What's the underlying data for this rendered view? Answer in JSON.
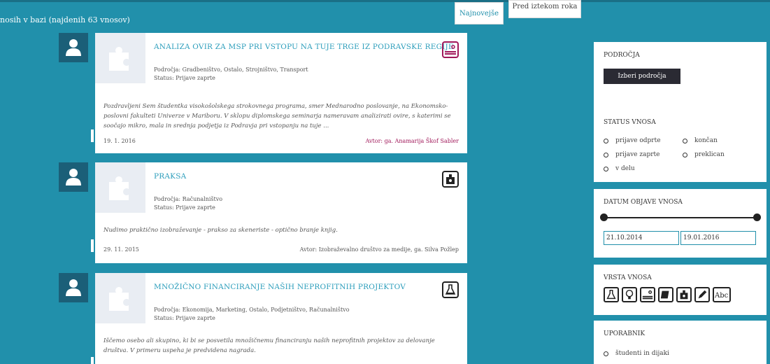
{
  "results": {
    "count_text": "nosih v bazi (najdenih 63 vnosov)"
  },
  "sort": {
    "newest": "Najnovejše",
    "before_deadline": "Pred iztekom roka"
  },
  "entries": [
    {
      "title": "ANALIZA OVIR ZA MSP PRI VSTOPU NA TUJE TRGE IZ PODRAVSKE REGIJE",
      "areas_label": "Področja:",
      "areas": "Gradbeništvo, Ostalo, Strojništvo, Transport",
      "status": "Status: Prijave zaprte",
      "excerpt": "Pozdravljeni Sem študentka visokošolskega strokovnega programa, smer Mednarodno poslovanje, na Ekonomsko-poslovni fakulteti Univerze v Mariboru. V sklopu diplomskega seminarja nameravam analizirati ovire, s katerimi se soočajo mikro, mala in srednja podjetja iz Podravja pri vstopanju na tuje ...",
      "date": "19. 1. 2016",
      "author": "Avtor: ga. Anamarija Škof Sabler",
      "type_icon": "report-icon"
    },
    {
      "title": "PRAKSA",
      "areas_label": "Področja:",
      "areas": "Računalništvo",
      "status": "Status: Prijave zaprte",
      "excerpt": "Nudimo praktično izobraževanje - prakso za skeneriste - optično branje knjig.",
      "date": "29. 11. 2015",
      "author": "Avtor: Izobraževalno društvo za medije, ga. Silva Požlep",
      "type_icon": "badge-icon"
    },
    {
      "title": "MNOŽIČNO FINANCIRANJE NAŠIH NEPROFITNIH PROJEKTOV",
      "areas_label": "Področja:",
      "areas": "Ekonomija, Marketing, Ostalo, Podjetništvo, Računalništvo",
      "status": "Status: Prijave zaprte",
      "excerpt": "Iščemo osebo ali skupino, ki bi se posvetila množičnemu financiranju naših neprofitnih projektov za delovanje društva. V primeru uspeha je predvidena nagrada.",
      "date": "",
      "author": "",
      "type_icon": "flask-icon"
    }
  ],
  "filters": {
    "areas": {
      "title": "PODROČJA",
      "button": "Izberi področja"
    },
    "status": {
      "title": "STATUS VNOSA",
      "options": [
        "prijave odprte",
        "končan",
        "prijave zaprte",
        "preklican",
        "v delu"
      ]
    },
    "date": {
      "title": "DATUM OBJAVE VNOSA",
      "from": "21.10.2014",
      "to": "19.01.2016",
      "range_fraction": [
        0,
        1
      ]
    },
    "type": {
      "title": "VRSTA VNOSA",
      "icons": [
        "flask-icon",
        "bulb-icon",
        "report-icon",
        "book-icon",
        "badge-icon",
        "pencil-icon",
        "abc-icon"
      ]
    },
    "user": {
      "title": "UPORABNIK",
      "options": [
        "študenti in dijaki"
      ]
    }
  },
  "colors": {
    "background": "#2190ab",
    "accent_pink": "#a0185a",
    "dark": "#2a2a33",
    "link": "#2b9dbb"
  }
}
